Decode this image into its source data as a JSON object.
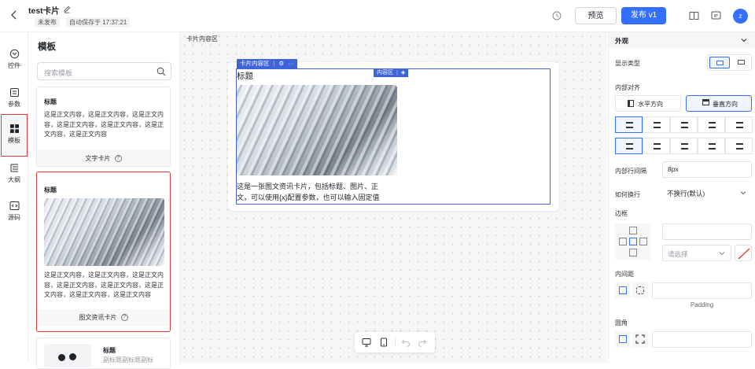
{
  "header": {
    "title": "test卡片",
    "status_badge": "未发布",
    "autosave": "自动保存于 17:37:21",
    "preview_label": "预览",
    "publish_label": "发布 v1",
    "avatar": "z"
  },
  "leftnav": {
    "items": [
      {
        "label": "控件",
        "icon": "widget-icon"
      },
      {
        "label": "参数",
        "icon": "param-icon"
      },
      {
        "label": "模板",
        "icon": "grid-icon"
      },
      {
        "label": "大纲",
        "icon": "outline-icon"
      },
      {
        "label": "源码",
        "icon": "code-icon"
      }
    ]
  },
  "templates": {
    "title": "模板",
    "search_placeholder": "搜索模板",
    "cards": [
      {
        "title": "标题",
        "body": "这是正文内容，这是正文内容，这是正文内容，这是正文内容，这是正文内容，这是正文内容，这是正文内容",
        "footer": "文字卡片"
      },
      {
        "title": "标题",
        "body": "这是正文内容，这是正文内容，这是正文内容，这是正文内容，这是正文内容，这是正文内容，这是正文内容，这是正文内容",
        "footer": "图文资讯卡片"
      },
      {
        "title": "标题",
        "body": "副标题副标题副标"
      }
    ]
  },
  "canvas": {
    "label": "卡片内容区",
    "card_tag": "卡片内容区",
    "inner_tag": "内容区",
    "card_title": "标题",
    "card_text": "这是一张图文资讯卡片，包括标题、图片、正文，可以使用{x}配置参数，也可以输入固定值"
  },
  "props": {
    "section": "外观",
    "display_type": "显示类型",
    "inner_align": "内部对齐",
    "horizontal": "水平方向",
    "vertical": "垂直方向",
    "row_gap_label": "内部行间隔",
    "row_gap_value": "8px",
    "wrap_label": "如何换行",
    "wrap_value": "不换行(默认)",
    "border_label": "边框",
    "border_select_placeholder": "请选择",
    "padding_label": "内间距",
    "padding_caption": "Padding",
    "radius_label": "圆角"
  }
}
